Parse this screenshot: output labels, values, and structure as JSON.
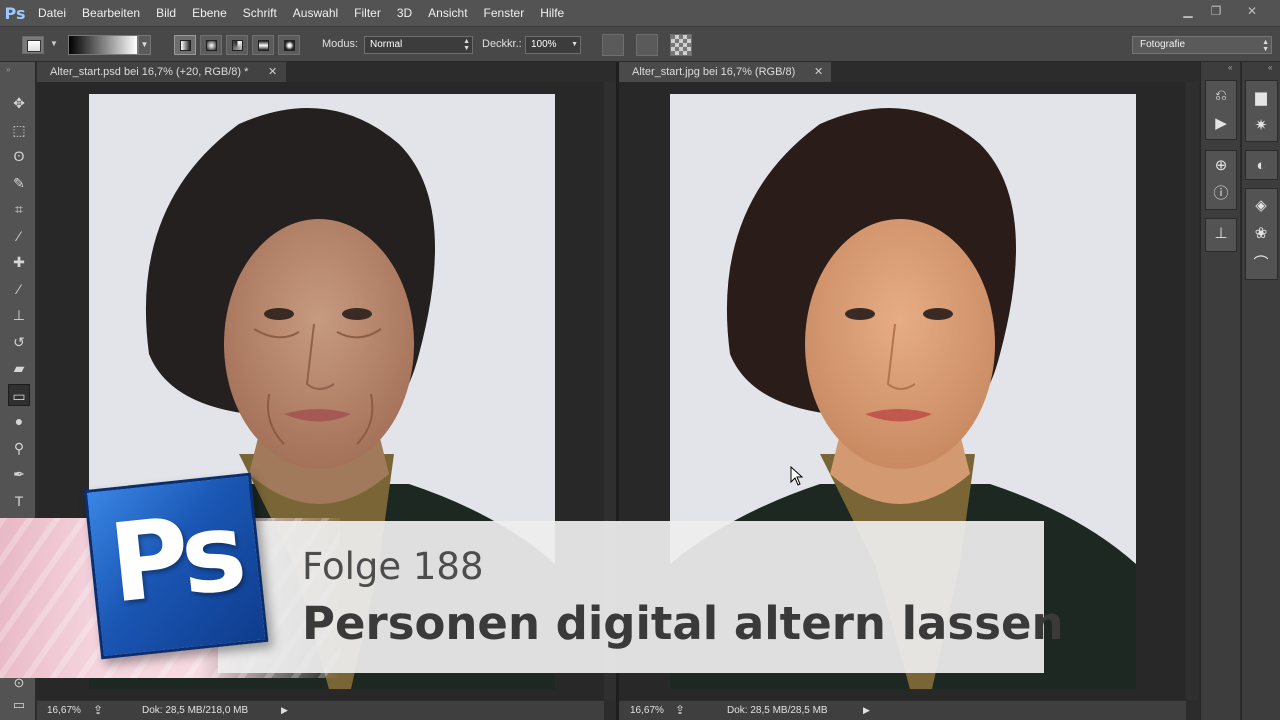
{
  "app": {
    "name": "Adobe Photoshop CS6",
    "logo_text": "Ps"
  },
  "menu": [
    "Datei",
    "Bearbeiten",
    "Bild",
    "Ebene",
    "Schrift",
    "Auswahl",
    "Filter",
    "3D",
    "Ansicht",
    "Fenster",
    "Hilfe"
  ],
  "window_controls": {
    "minimize": "▁",
    "restore": "❐",
    "close": "✕"
  },
  "options_bar": {
    "mode_label": "Modus:",
    "mode_value": "Normal",
    "opacity_label": "Deckkr.:",
    "opacity_value": "100%",
    "workspace": "Fotografie"
  },
  "tools": [
    "move-tool",
    "marquee-tool",
    "lasso-tool",
    "quick-selection-tool",
    "crop-tool",
    "eyedropper-tool",
    "spot-healing-tool",
    "brush-tool",
    "clone-stamp-tool",
    "history-brush-tool",
    "eraser-tool",
    "gradient-tool",
    "blur-tool",
    "dodge-tool",
    "pen-tool",
    "type-tool"
  ],
  "tool_glyphs": {
    "move-tool": "✥",
    "marquee-tool": "⬚",
    "lasso-tool": "ʘ",
    "quick-selection-tool": "✎",
    "crop-tool": "⌗",
    "eyedropper-tool": "⁄",
    "spot-healing-tool": "✚",
    "brush-tool": "⁄",
    "clone-stamp-tool": "⊥",
    "history-brush-tool": "↺",
    "eraser-tool": "▰",
    "gradient-tool": "▭",
    "blur-tool": "●",
    "dodge-tool": "⚲",
    "pen-tool": "✒",
    "type-tool": "T"
  },
  "active_tool": "gradient-tool",
  "documents": [
    {
      "tab_title": "Alter_start.psd bei 16,7% (+20, RGB/8) *",
      "zoom": "16,67%",
      "doc_info": "Dok: 28,5 MB/218,0 MB",
      "variant": "aged"
    },
    {
      "tab_title": "Alter_start.jpg bei 16,7% (RGB/8)",
      "zoom": "16,67%",
      "doc_info": "Dok: 28,5 MB/28,5 MB",
      "variant": "original"
    }
  ],
  "right_panel_icons": {
    "dock1": [
      "history-icon",
      "actions-play-icon",
      "clone-source-icon",
      "info-icon",
      "tool-presets-icon"
    ],
    "dock2": [
      "histogram-icon",
      "navigator-icon",
      "adjustments-icon",
      "layers-icon",
      "channels-icon",
      "paths-icon"
    ]
  },
  "overlay": {
    "badge_text": "Ps",
    "episode": "Folge 188",
    "title": "Personen digital altern lassen"
  },
  "colors": {
    "ui_bg": "#535353",
    "canvas_bg": "#282828",
    "photo_bg": "#e2e3e8",
    "badge_blue": "#1a56b4"
  }
}
